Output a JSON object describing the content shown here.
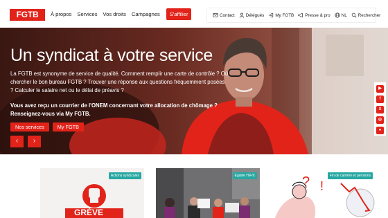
{
  "header": {
    "logo": "FGTB",
    "nav": [
      "À propos",
      "Services",
      "Vos droits",
      "Campagnes"
    ],
    "affilier": "S'affilier",
    "util": {
      "contact": "Contact",
      "delegues": "Délégués",
      "myfgtb": "My FGTB",
      "presse": "Presse & pro",
      "lang": "NL",
      "search": "Rechercher"
    }
  },
  "hero": {
    "title": "Un syndicat à votre service",
    "description": "La FGTB est synonyme de service de qualité. Comment remplir une carte de contrôle ? Où chercher le bon bureau FGTB ? Trouver une réponse aux questions fréquemment posées ? Calculer le salaire net ou le délai de préavis ?",
    "cta": "Vous avez reçu un courrier de l'ONEM concernant votre allocation de chômage ? Renseignez-vous via My FGTB.",
    "btn_services": "Nos services",
    "btn_myfgtb": "My FGTB",
    "prev": "‹",
    "next": "›"
  },
  "social": [
    "youtube-icon",
    "facebook-icon",
    "x-icon",
    "instagram-icon",
    "lemon8-icon"
  ],
  "cards": [
    {
      "tag": "Actions syndicales",
      "text": "GRÈVE"
    },
    {
      "tag": "Égalité H/F/X"
    },
    {
      "tag": "Fin de carrière et pensions"
    }
  ],
  "colors": {
    "brand": "#e2231a",
    "tag": "#27a7a1"
  }
}
